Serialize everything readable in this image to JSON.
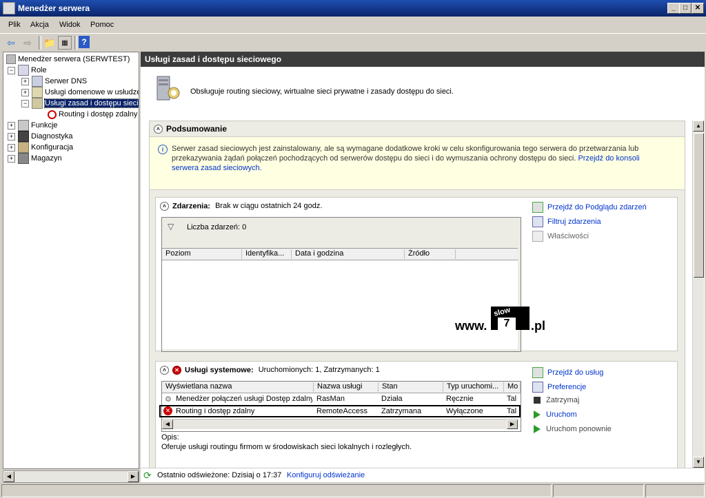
{
  "window": {
    "title": "Menedżer serwera"
  },
  "menu": [
    "Plik",
    "Akcja",
    "Widok",
    "Pomoc"
  ],
  "tree": {
    "root": "Menedżer serwera (SERWTEST)",
    "role": "Role",
    "dns": "Serwer DNS",
    "domain": "Usługi domenowe w usłudze",
    "nps": "Usługi zasad i dostępu sieci",
    "routing": "Routing i dostęp zdalny",
    "functions": "Funkcje",
    "diagnostics": "Diagnostyka",
    "config": "Konfiguracja",
    "storage": "Magazyn"
  },
  "pane": {
    "title": "Usługi zasad i dostępu sieciowego",
    "description": "Obsługuje routing sieciowy, wirtualne sieci prywatne i zasady dostępu do sieci."
  },
  "summary": {
    "header": "Podsumowanie",
    "info_text": "Serwer zasad sieciowych jest zainstalowany, ale są wymagane dodatkowe kroki w celu skonfigurowania tego serwera do przetwarzania lub przekazywania żądań połączeń pochodzących od serwerów dostępu do sieci i do wymuszania ochrony dostępu do sieci. ",
    "info_link": "Przejdź do konsoli serwera zasad sieciowych."
  },
  "events": {
    "header": "Zdarzenia:",
    "status": "Brak w ciągu ostatnich 24 godz.",
    "filter_count": "Liczba zdarzeń: 0",
    "columns": [
      "Poziom",
      "Identyfika...",
      "Data i godzina",
      "Źródło"
    ],
    "actions": [
      "Przejdź do Podglądu zdarzeń",
      "Filtruj zdarzenia",
      "Właściwości"
    ]
  },
  "watermark": {
    "prefix": "www.",
    "badge_top": "slow",
    "badge_num": "7",
    "suffix": ".pl"
  },
  "services": {
    "header": "Usługi systemowe:",
    "status": "Uruchomionych: 1, Zatrzymanych: 1",
    "columns": [
      "Wyświetlana nazwa",
      "Nazwa usługi",
      "Stan",
      "Typ uruchomi...",
      "Mo"
    ],
    "rows": [
      [
        "Menedżer połączeń usługi Dostęp zdalny",
        "RasMan",
        "Działa",
        "Ręcznie",
        "Tal"
      ],
      [
        "Routing i dostęp zdalny",
        "RemoteAccess",
        "Zatrzymana",
        "Wyłączone",
        "Tal"
      ]
    ],
    "desc_label": "Opis:",
    "desc_text": "Oferuje usługi routingu firmom w środowiskach sieci lokalnych i rozległych.",
    "actions": [
      "Przejdź do usług",
      "Preferencje",
      "Zatrzymaj",
      "Uruchom",
      "Uruchom ponownie"
    ]
  },
  "refresh": {
    "last": "Ostatnio odświeżone: Dzisiaj o 17:37",
    "configure": "Konfiguruj odświeżanie"
  }
}
